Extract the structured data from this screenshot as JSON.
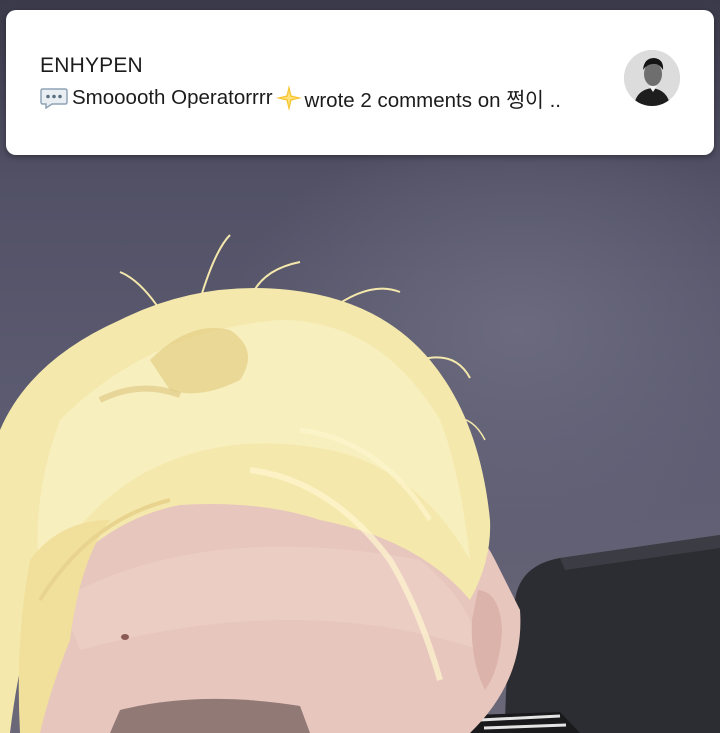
{
  "notification": {
    "app_name": "ENHYPEN",
    "message_prefix": "Smooooth Operatorrrr",
    "message_suffix": "wrote 2 comments on 쩡이 ..",
    "icons": {
      "leading": "speech-bubble-icon",
      "inline": "glowing-star-icon"
    },
    "avatar": "user-avatar"
  },
  "background": {
    "content": "live-video-frame",
    "colors": {
      "wall": "#5d5c72",
      "hair": "#f3e7ab",
      "skin": "#e8c9c0",
      "chair": "#2b2c30"
    }
  }
}
